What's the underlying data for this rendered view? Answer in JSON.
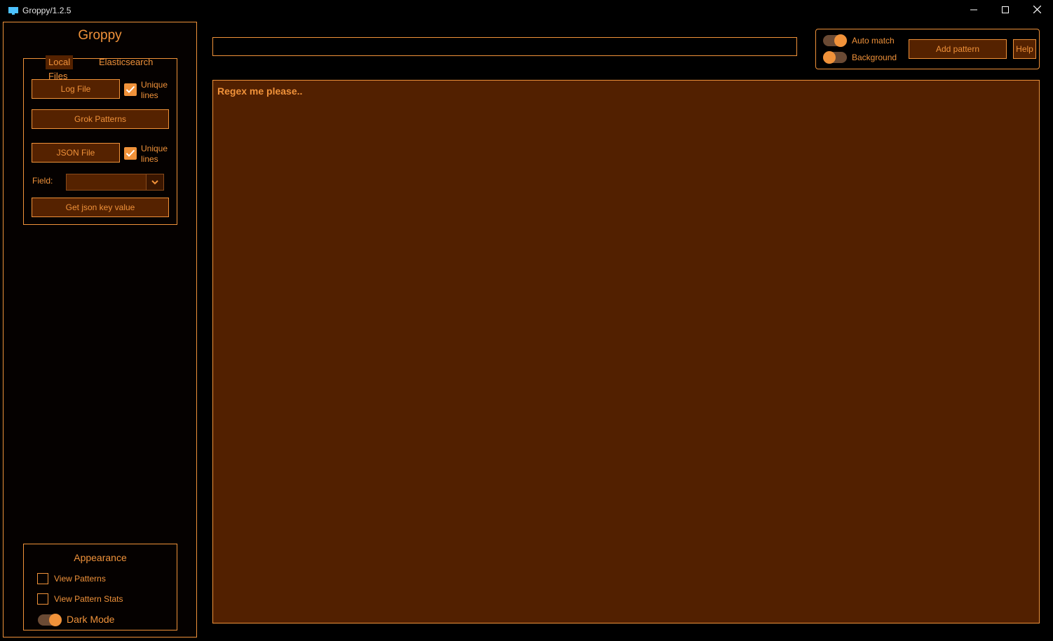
{
  "window": {
    "title": "Groppy/1.2.5"
  },
  "sidebar": {
    "brand": "Groppy",
    "tabs": [
      "Local Files",
      "Elasticsearch"
    ],
    "log_file_label": "Log File",
    "unique_lines_label": "Unique\nlines",
    "grok_patterns_label": "Grok Patterns",
    "json_file_label": "JSON File",
    "field_label": "Field:",
    "field_value": "",
    "get_json_label": "Get json key value"
  },
  "appearance": {
    "title": "Appearance",
    "view_patterns": "View Patterns",
    "view_pattern_stats": "View Pattern Stats",
    "dark_mode": "Dark Mode"
  },
  "top": {
    "pattern_value": "",
    "auto_match": "Auto match",
    "background": "Background",
    "add_pattern": "Add pattern",
    "help": "Help"
  },
  "editor": {
    "placeholder": "Regex me please.."
  },
  "colors": {
    "accent": "#f0923a",
    "panel": "#552200",
    "editor_bg": "#522000"
  }
}
